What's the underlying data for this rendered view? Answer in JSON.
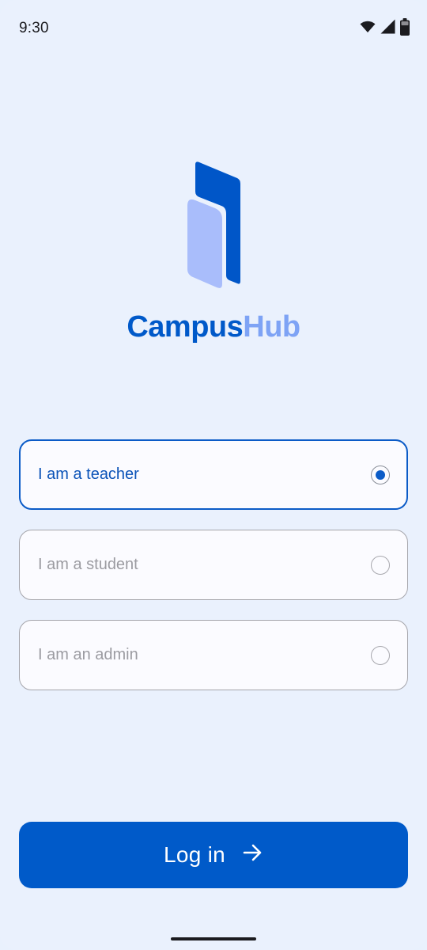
{
  "status_bar": {
    "time": "9:30",
    "icons": [
      "wifi-icon",
      "cellular-signal-icon",
      "battery-icon"
    ]
  },
  "brand": {
    "part1": "Campus",
    "part2": "Hub",
    "colors": {
      "primary": "#0059c9",
      "secondary": "#7ea3f5",
      "logo_back": "#0056c8",
      "logo_front": "#a9bdfb"
    }
  },
  "options": [
    {
      "label": "I am a teacher",
      "selected": true
    },
    {
      "label": "I am a student",
      "selected": false
    },
    {
      "label": "I am an admin",
      "selected": false
    }
  ],
  "login": {
    "label": "Log in",
    "icon": "arrow-right-icon"
  },
  "theme": {
    "background": "#eaf1fd",
    "accent": "#005ac9"
  }
}
